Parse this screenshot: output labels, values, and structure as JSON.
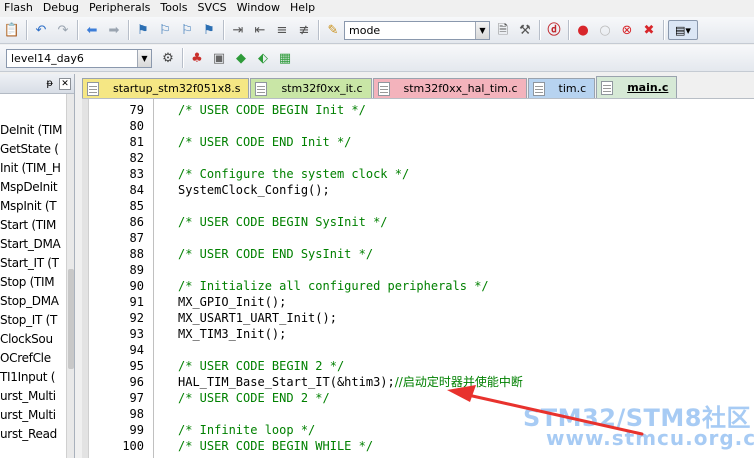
{
  "menu": [
    "Flash",
    "Debug",
    "Peripherals",
    "Tools",
    "SVCS",
    "Window",
    "Help"
  ],
  "toolbar": {
    "find_combo_value": "mode"
  },
  "toolbar2": {
    "target_combo_value": "level14_day6"
  },
  "left_panel": {
    "pin_glyph": "ᵽ",
    "close_glyph": "✕",
    "items": [
      "DeInit (TIM",
      "GetState (",
      "Init (TIM_H",
      "MspDeInit",
      "MspInit (T",
      "Start (TIM",
      "Start_DMA",
      "Start_IT (T",
      "Stop (TIM",
      "Stop_DMA",
      "Stop_IT (T",
      "ClockSou",
      "OCrefCle",
      "TI1Input (",
      "urst_Multi",
      "urst_Multi",
      "urst_Read"
    ]
  },
  "tabs": [
    {
      "label": "startup_stm32f051x8.s",
      "color": "#f5e784",
      "active": false
    },
    {
      "label": "stm32f0xx_it.c",
      "color": "#c9e6a6",
      "active": false
    },
    {
      "label": "stm32f0xx_hal_tim.c",
      "color": "#f3b3bc",
      "active": false
    },
    {
      "label": "tim.c",
      "color": "#b7d3f0",
      "active": false
    },
    {
      "label": "main.c",
      "color": "#d6e9d6",
      "active": true
    }
  ],
  "code_lines": [
    {
      "num": "79",
      "text": "/* USER CODE BEGIN Init */",
      "kind": "comment"
    },
    {
      "num": "80",
      "text": "",
      "kind": "plain"
    },
    {
      "num": "81",
      "text": "/* USER CODE END Init */",
      "kind": "comment"
    },
    {
      "num": "82",
      "text": "",
      "kind": "plain"
    },
    {
      "num": "83",
      "text": "/* Configure the system clock */",
      "kind": "comment"
    },
    {
      "num": "84",
      "text": "SystemClock_Config();",
      "kind": "plain"
    },
    {
      "num": "85",
      "text": "",
      "kind": "plain"
    },
    {
      "num": "86",
      "text": "/* USER CODE BEGIN SysInit */",
      "kind": "comment"
    },
    {
      "num": "87",
      "text": "",
      "kind": "plain"
    },
    {
      "num": "88",
      "text": "/* USER CODE END SysInit */",
      "kind": "comment"
    },
    {
      "num": "89",
      "text": "",
      "kind": "plain"
    },
    {
      "num": "90",
      "text": "/* Initialize all configured peripherals */",
      "kind": "comment"
    },
    {
      "num": "91",
      "text": "MX_GPIO_Init();",
      "kind": "plain"
    },
    {
      "num": "92",
      "text": "MX_USART1_UART_Init();",
      "kind": "plain"
    },
    {
      "num": "93",
      "text": "MX_TIM3_Init();",
      "kind": "plain"
    },
    {
      "num": "94",
      "text": "",
      "kind": "plain"
    },
    {
      "num": "95",
      "text": "/* USER CODE BEGIN 2 */",
      "kind": "comment"
    },
    {
      "num": "96",
      "text": "HAL_TIM_Base_Start_IT(&htim3);",
      "kind": "mixed",
      "comment": "//启动定时器并使能中断"
    },
    {
      "num": "97",
      "text": "/* USER CODE END 2 */",
      "kind": "comment"
    },
    {
      "num": "98",
      "text": "",
      "kind": "plain"
    },
    {
      "num": "99",
      "text": "/* Infinite loop */",
      "kind": "comment"
    },
    {
      "num": "100",
      "text": "/* USER CODE BEGIN WHILE */",
      "kind": "comment"
    }
  ],
  "watermark": {
    "line1": "STM32/STM8社区",
    "line2": "www.stmcu.org.cn"
  },
  "colors": {
    "comment": "#008000",
    "arrow": "#e8322d"
  }
}
